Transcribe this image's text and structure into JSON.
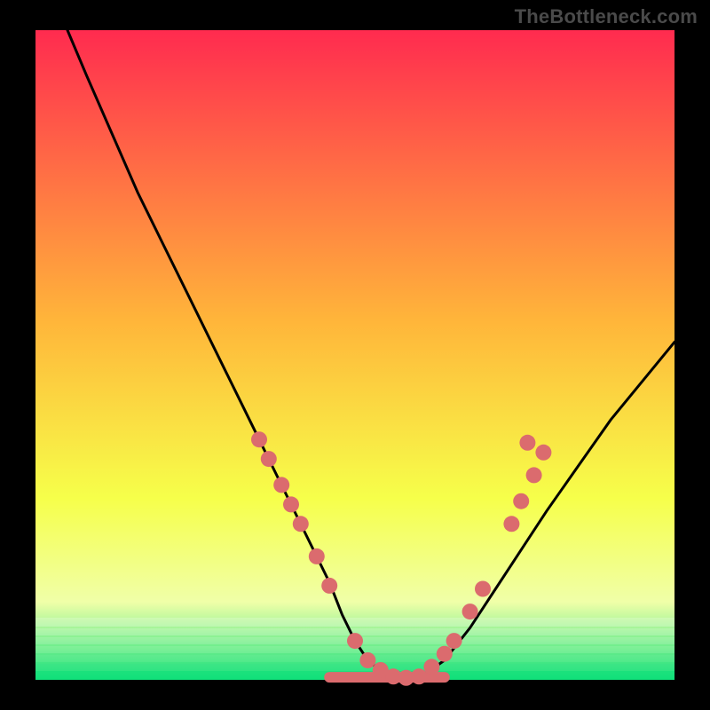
{
  "watermark": "TheBottleneck.com",
  "colors": {
    "gradient_top": "#ff2b4f",
    "gradient_mid1": "#ffb63a",
    "gradient_mid2": "#f6ff4a",
    "gradient_low": "#f0ffa8",
    "gradient_bottom": "#11e07a",
    "curve": "#000000",
    "markers": "#db6b6e",
    "frame": "#000000"
  },
  "chart_data": {
    "type": "line",
    "title": "",
    "xlabel": "",
    "ylabel": "",
    "xlim": [
      0,
      100
    ],
    "ylim": [
      0,
      100
    ],
    "series": [
      {
        "name": "bottleneck-curve",
        "x": [
          5,
          8,
          12,
          16,
          20,
          24,
          28,
          32,
          35,
          38,
          41,
          43.5,
          46,
          48,
          50,
          52,
          54.5,
          57,
          60,
          64,
          68,
          72,
          76,
          80,
          85,
          90,
          95,
          100
        ],
        "values": [
          100,
          93,
          84,
          75,
          67,
          59,
          51,
          43,
          37,
          31,
          25,
          20,
          15,
          10,
          6,
          3,
          1,
          0.2,
          0.2,
          3,
          8,
          14,
          20,
          26,
          33,
          40,
          46,
          52
        ]
      }
    ],
    "markers": [
      {
        "name": "left-cluster",
        "x": 35.0,
        "y": 37.0
      },
      {
        "name": "left-cluster",
        "x": 36.5,
        "y": 34.0
      },
      {
        "name": "left-cluster",
        "x": 38.5,
        "y": 30.0
      },
      {
        "name": "left-cluster",
        "x": 40.0,
        "y": 27.0
      },
      {
        "name": "left-cluster",
        "x": 41.5,
        "y": 24.0
      },
      {
        "name": "left-cluster",
        "x": 44.0,
        "y": 19.0
      },
      {
        "name": "left-cluster",
        "x": 46.0,
        "y": 14.5
      },
      {
        "name": "trough",
        "x": 50.0,
        "y": 6.0
      },
      {
        "name": "trough",
        "x": 52.0,
        "y": 3.0
      },
      {
        "name": "trough",
        "x": 54.0,
        "y": 1.5
      },
      {
        "name": "trough",
        "x": 56.0,
        "y": 0.5
      },
      {
        "name": "trough",
        "x": 58.0,
        "y": 0.3
      },
      {
        "name": "trough",
        "x": 60.0,
        "y": 0.5
      },
      {
        "name": "right-cluster",
        "x": 62.0,
        "y": 2.0
      },
      {
        "name": "right-cluster",
        "x": 64.0,
        "y": 4.0
      },
      {
        "name": "right-cluster",
        "x": 65.5,
        "y": 6.0
      },
      {
        "name": "right-cluster",
        "x": 68.0,
        "y": 10.5
      },
      {
        "name": "right-cluster",
        "x": 70.0,
        "y": 14.0
      },
      {
        "name": "right-cluster",
        "x": 74.5,
        "y": 24.0
      },
      {
        "name": "right-cluster",
        "x": 76.0,
        "y": 27.5
      },
      {
        "name": "right-cluster",
        "x": 78.0,
        "y": 31.5
      },
      {
        "name": "right-cluster",
        "x": 79.5,
        "y": 35.0
      },
      {
        "name": "right-outlier",
        "x": 77.0,
        "y": 36.5
      }
    ],
    "trough_band": {
      "x_start": 46,
      "x_end": 64,
      "y": 0.4
    }
  }
}
